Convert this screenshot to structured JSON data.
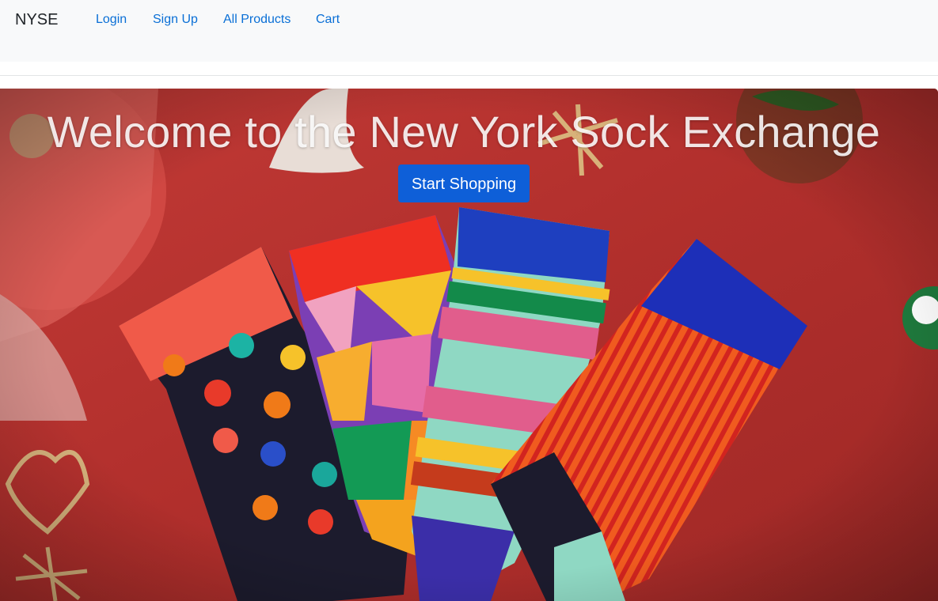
{
  "nav": {
    "brand": "NYSE",
    "links": [
      {
        "label": "Login"
      },
      {
        "label": "Sign Up"
      },
      {
        "label": "All Products"
      },
      {
        "label": "Cart"
      }
    ]
  },
  "hero": {
    "title": "Welcome to the New York Sock Exchange",
    "cta_label": "Start Shopping",
    "image_alt": "colorful-socks-photo"
  },
  "colors": {
    "nav_bg": "#f8f9fa",
    "link": "#0a6fd6",
    "cta_bg": "#0e5fd8",
    "hero_bg": "#b8312f"
  }
}
